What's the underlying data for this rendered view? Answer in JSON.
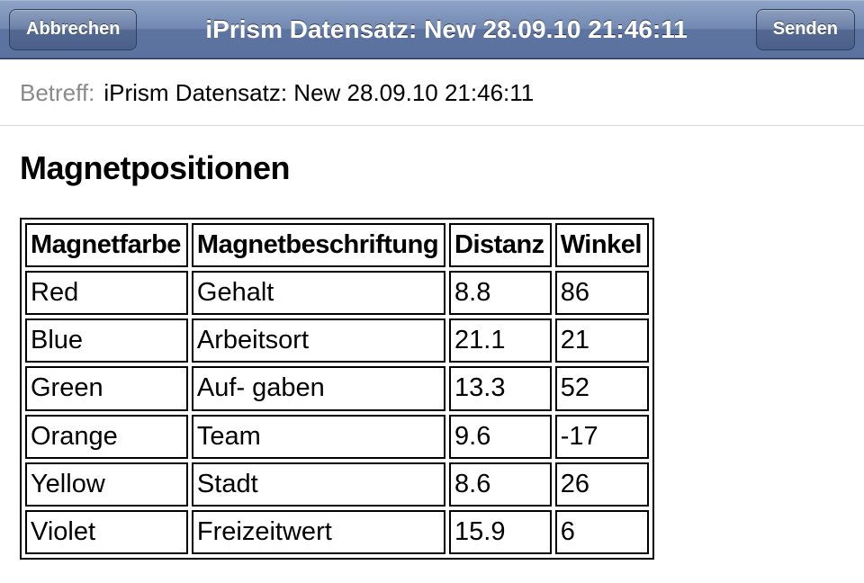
{
  "navbar": {
    "cancel_label": "Abbrechen",
    "title": "iPrism Datensatz: New 28.09.10 21:46:11",
    "send_label": "Senden"
  },
  "subject": {
    "label": "Betreff:",
    "value": "iPrism Datensatz: New 28.09.10 21:46:11"
  },
  "section_heading": "Magnetpositionen",
  "table": {
    "headers": [
      "Magnetfarbe",
      "Magnetbeschriftung",
      "Distanz",
      "Winkel"
    ],
    "rows": [
      {
        "c0": "Red",
        "c1": "Gehalt",
        "c2": "8.8",
        "c3": "86"
      },
      {
        "c0": "Blue",
        "c1": "Arbeitsort",
        "c2": "21.1",
        "c3": "21"
      },
      {
        "c0": "Green",
        "c1": "Auf- gaben",
        "c2": "13.3",
        "c3": "52"
      },
      {
        "c0": "Orange",
        "c1": "Team",
        "c2": "9.6",
        "c3": "-17"
      },
      {
        "c0": "Yellow",
        "c1": "Stadt",
        "c2": "8.6",
        "c3": "26"
      },
      {
        "c0": "Violet",
        "c1": "Freizeitwert",
        "c2": "15.9",
        "c3": "6"
      }
    ]
  },
  "chart_data": {
    "type": "table",
    "title": "Magnetpositionen",
    "columns": [
      "Magnetfarbe",
      "Magnetbeschriftung",
      "Distanz",
      "Winkel"
    ],
    "data": [
      [
        "Red",
        "Gehalt",
        8.8,
        86
      ],
      [
        "Blue",
        "Arbeitsort",
        21.1,
        21
      ],
      [
        "Green",
        "Auf- gaben",
        13.3,
        52
      ],
      [
        "Orange",
        "Team",
        9.6,
        -17
      ],
      [
        "Yellow",
        "Stadt",
        8.6,
        26
      ],
      [
        "Violet",
        "Freizeitwert",
        15.9,
        6
      ]
    ]
  }
}
